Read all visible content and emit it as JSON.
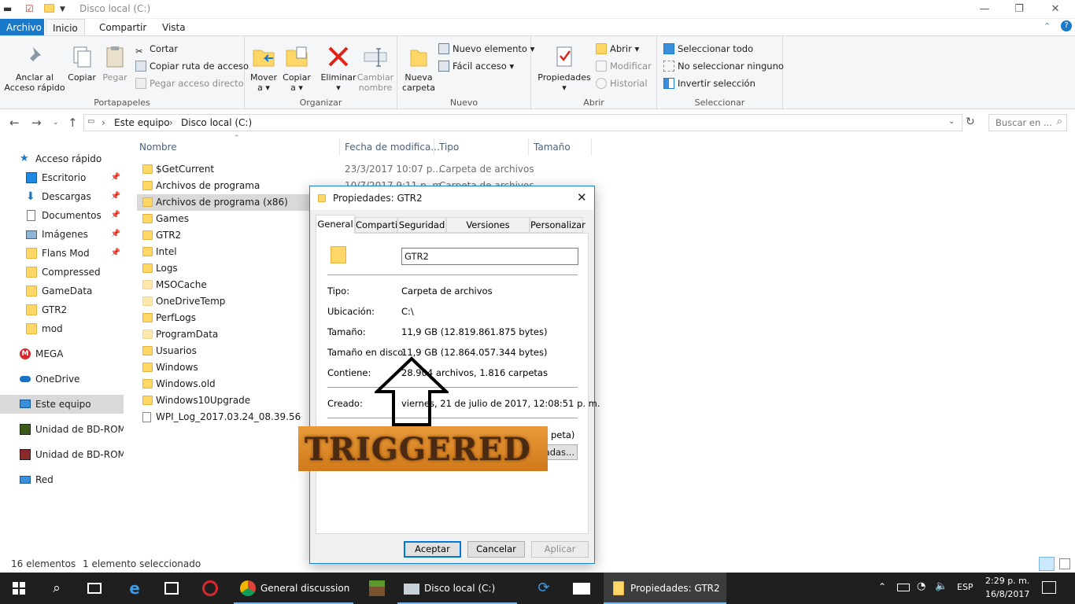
{
  "window": {
    "title": "Disco local (C:)"
  },
  "ribbon_tabs": [
    "Archivo",
    "Inicio",
    "Compartir",
    "Vista"
  ],
  "ribbon": {
    "portapapeles": {
      "title": "Portapapeles",
      "anclar": "Anclar al Acceso rápido",
      "copiar": "Copiar",
      "pegar": "Pegar",
      "cortar": "Cortar",
      "copiar_ruta": "Copiar ruta de acceso",
      "pegar_acceso": "Pegar acceso directo"
    },
    "organizar": {
      "title": "Organizar",
      "mover": "Mover a",
      "copiar_a": "Copiar a",
      "eliminar": "Eliminar",
      "cambiar": "Cambiar nombre"
    },
    "nuevo": {
      "title": "Nuevo",
      "nueva_carpeta": "Nueva carpeta",
      "nuevo_elemento": "Nuevo elemento",
      "facil_acceso": "Fácil acceso"
    },
    "abrir": {
      "title": "Abrir",
      "propiedades": "Propiedades",
      "abrir": "Abrir",
      "modificar": "Modificar",
      "historial": "Historial"
    },
    "seleccionar": {
      "title": "Seleccionar",
      "todo": "Seleccionar todo",
      "ninguno": "No seleccionar ninguno",
      "invertir": "Invertir selección"
    }
  },
  "address": {
    "crumbs": [
      "Este equipo",
      "Disco local (C:)"
    ],
    "search_placeholder": "Buscar en ..."
  },
  "sidebar": [
    {
      "label": "Acceso rápido",
      "icon": "star-icon"
    },
    {
      "label": "Escritorio",
      "icon": "desktop-icon",
      "pin": true
    },
    {
      "label": "Descargas",
      "icon": "download-icon",
      "pin": true
    },
    {
      "label": "Documentos",
      "icon": "document-icon",
      "pin": true
    },
    {
      "label": "Imágenes",
      "icon": "pictures-icon",
      "pin": true
    },
    {
      "label": "Flans Mod",
      "icon": "folder-icon",
      "pin": true
    },
    {
      "label": "Compressed",
      "icon": "folder-icon"
    },
    {
      "label": "GameData",
      "icon": "folder-icon"
    },
    {
      "label": "GTR2",
      "icon": "folder-icon"
    },
    {
      "label": "mod",
      "icon": "folder-icon"
    },
    {
      "label": "MEGA",
      "icon": "mega-icon"
    },
    {
      "label": "OneDrive",
      "icon": "onedrive-icon"
    },
    {
      "label": "Este equipo",
      "icon": "computer-icon"
    },
    {
      "label": "Unidad de BD-ROM (",
      "icon": "bdrom-icon"
    },
    {
      "label": "Unidad de BD-ROM (",
      "icon": "bdrom-icon"
    },
    {
      "label": "Red",
      "icon": "network-icon"
    }
  ],
  "columns": [
    "Nombre",
    "Fecha de modifica...",
    "Tipo",
    "Tamaño"
  ],
  "files": [
    {
      "name": "$GetCurrent",
      "date": "23/3/2017 10:07 p....",
      "type": "Carpeta de archivos"
    },
    {
      "name": "Archivos de programa",
      "date": "10/7/2017 9:11 p. m.",
      "type": "Carpeta de archivos"
    },
    {
      "name": "Archivos de programa (x86)"
    },
    {
      "name": "Games"
    },
    {
      "name": "GTR2"
    },
    {
      "name": "Intel"
    },
    {
      "name": "Logs"
    },
    {
      "name": "MSOCache"
    },
    {
      "name": "OneDriveTemp"
    },
    {
      "name": "PerfLogs"
    },
    {
      "name": "ProgramData"
    },
    {
      "name": "Usuarios"
    },
    {
      "name": "Windows"
    },
    {
      "name": "Windows.old"
    },
    {
      "name": "Windows10Upgrade"
    },
    {
      "name": "WPI_Log_2017.03.24_08.39.56"
    }
  ],
  "status": {
    "count": "16 elementos",
    "selected": "1 elemento seleccionado"
  },
  "dialog": {
    "title": "Propiedades: GTR2",
    "tabs": [
      "General",
      "Compartir",
      "Seguridad",
      "Versiones anteriores",
      "Personalizar"
    ],
    "name_value": "GTR2",
    "tipo_label": "Tipo:",
    "tipo": "Carpeta de archivos",
    "ubicacion_label": "Ubicación:",
    "ubicacion": "C:\\",
    "tamano_label": "Tamaño:",
    "tamano": "11,9 GB (12.819.861.875 bytes)",
    "disco_label": "Tamaño en disco:",
    "disco": "11,9 GB (12.864.057.344 bytes)",
    "contiene_label": "Contiene:",
    "contiene": "28.904 archivos, 1.816 carpetas",
    "creado_label": "Creado:",
    "creado": "viernes, 21 de julio de 2017, 12:08:51 p. m.",
    "attr_partial": "peta)",
    "adv_partial": "adas...",
    "ok": "Aceptar",
    "cancel": "Cancelar",
    "apply": "Aplicar"
  },
  "overlay": {
    "text": "TRIGGERED"
  },
  "taskbar": {
    "apps": [
      {
        "label": "General discussion ...",
        "icon": "chrome-icon"
      },
      {
        "label": "Disco local (C:)",
        "icon": "explorer-icon"
      },
      {
        "label": "Propiedades: GTR2",
        "icon": "folder-icon"
      }
    ],
    "lang": "ESP",
    "time": "2:29 p. m.",
    "date": "16/8/2017"
  },
  "colors": {
    "accent": "#1979ca",
    "folder": "#ffd767",
    "taskbar": "#1f1f1f",
    "selected": "#cce8ff"
  }
}
